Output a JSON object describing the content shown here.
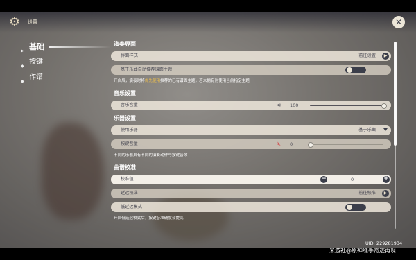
{
  "window": {
    "title": "设置"
  },
  "sidebar": {
    "items": [
      {
        "label": "基础",
        "active": true
      },
      {
        "label": "按键",
        "active": false
      },
      {
        "label": "作谱",
        "active": false
      }
    ]
  },
  "sections": {
    "performance": {
      "heading": "演奏界面",
      "interface_style": {
        "label": "界面样式",
        "value": "前往设置"
      },
      "auto_recommend": {
        "label": "基于乐曲自动推荐谱面主题",
        "enabled": false
      },
      "hint_before": "开启后，演奏时将",
      "hint_highlight": "优先使用",
      "hint_after": "推荐的已有谱面主题，若未拥有则使用当前指定主题"
    },
    "music": {
      "heading": "音乐设置",
      "music_volume": {
        "label": "音乐音量",
        "value": "100",
        "level": 100
      }
    },
    "instrument": {
      "heading": "乐器设置",
      "use_instrument": {
        "label": "使用乐器",
        "value": "基于乐曲"
      },
      "key_volume": {
        "label": "按键音量",
        "value": "0",
        "level": 0
      },
      "hint": "不同的乐器具有不同的演奏动作与按键音效"
    },
    "calibration": {
      "heading": "曲谱校准",
      "calibration_value": {
        "label": "校准值",
        "value": "0",
        "minus": "−",
        "plus": "+"
      },
      "delay_calibration": {
        "label": "延迟校准",
        "value": "前往校准"
      },
      "low_latency": {
        "label": "低延迟模式",
        "enabled": false
      },
      "hint": "开启低延迟模式后，按键音准确度会提高"
    }
  },
  "footer": {
    "uid": "UID: 229281934",
    "watermark": "米游社@原神缝手奇迹再现"
  },
  "icons": {
    "settings": "gear-icon",
    "close": "close-icon",
    "arrow": "arrow-right-icon",
    "speaker": "speaker-icon",
    "mute": "muted-speaker-icon",
    "dropdown": "chevron-down-icon"
  },
  "colors": {
    "accent_text": "#f2c24c",
    "row_bg": "#eee8dc",
    "dark_control": "#3b3e4a"
  }
}
